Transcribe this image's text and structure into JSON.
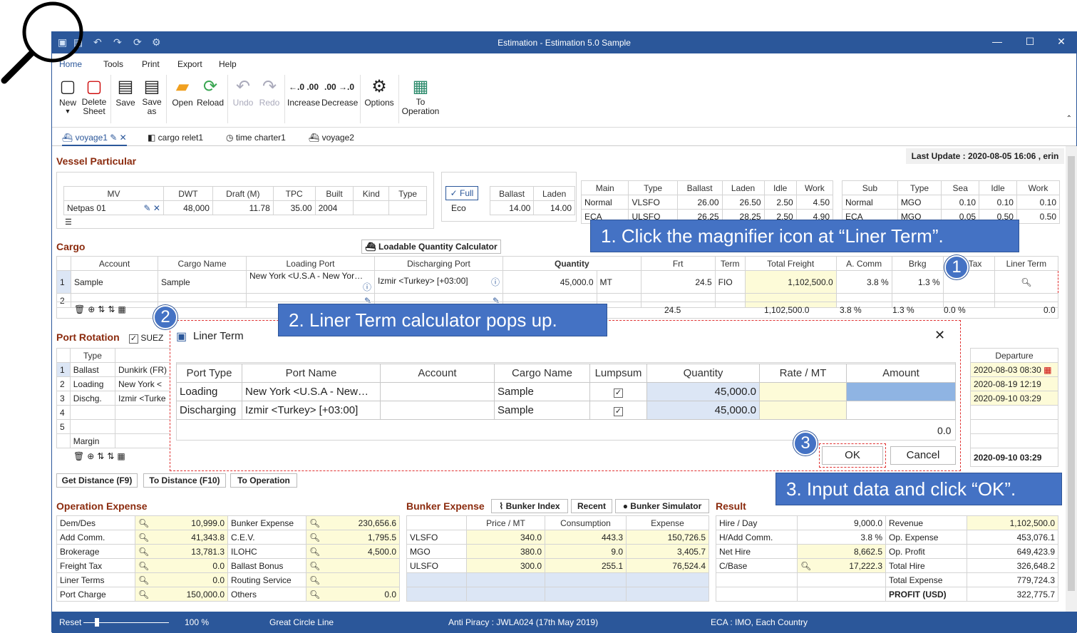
{
  "window": {
    "title": "Estimation - Estimation 5.0 Sample"
  },
  "menu": [
    "Home",
    "Tools",
    "Print",
    "Export",
    "Help"
  ],
  "ribbon": {
    "new": "New",
    "delete": "Delete\nSheet",
    "save": "Save",
    "save_as": "Save\nas",
    "open": "Open",
    "reload": "Reload",
    "undo": "Undo",
    "redo": "Redo",
    "increase": "Increase",
    "decrease": "Decrease",
    "options": "Options",
    "to_operation": "To\nOperation"
  },
  "tabs": [
    "voyage1",
    "cargo relet1",
    "time charter1",
    "voyage2"
  ],
  "last_update": "Last Update : 2020-08-05 16:06 , erin",
  "vessel": {
    "section": "Vessel Particular",
    "headers": [
      "MV",
      "DWT",
      "Draft (M)",
      "TPC",
      "Built",
      "Kind",
      "Type"
    ],
    "row": [
      "Netpas 01",
      "48,000",
      "11.78",
      "35.00",
      "2004",
      "",
      ""
    ]
  },
  "speed": {
    "full": "Full",
    "eco": "Eco",
    "headers": [
      "Ballast",
      "Laden"
    ],
    "row": [
      "14.00",
      "14.00"
    ]
  },
  "main_engine": {
    "headers": [
      "Main",
      "Type",
      "Ballast",
      "Laden",
      "Idle",
      "Work"
    ],
    "rows": [
      [
        "Normal",
        "VLSFO",
        "26.00",
        "26.50",
        "2.50",
        "4.50"
      ],
      [
        "ECA",
        "ULSFO",
        "26.25",
        "28.25",
        "2.50",
        "4.90"
      ]
    ]
  },
  "sub_engine": {
    "headers": [
      "Sub",
      "Type",
      "Sea",
      "Idle",
      "Work"
    ],
    "rows": [
      [
        "Normal",
        "MGO",
        "0.10",
        "0.10",
        "0.10"
      ],
      [
        "ECA",
        "MGO",
        "0.05",
        "0.50",
        "0.50"
      ]
    ]
  },
  "cargo": {
    "section": "Cargo",
    "lqc": "Loadable Quantity Calculator",
    "headers": [
      "Account",
      "Cargo Name",
      "Loading Port",
      "Discharging Port",
      "Quantity",
      "Frt",
      "Term",
      "Total Freight",
      "A. Comm",
      "Brkg",
      "Frt Tax",
      "Liner Term"
    ],
    "row": [
      "Sample",
      "Sample",
      "New York <U.S.A - New Yor…",
      "Izmir <Turkey> [+03:00]",
      "45,000.0",
      "MT",
      "24.5",
      "FIO",
      "1,102,500.0",
      "3.8 %",
      "1.3 %"
    ],
    "totals": [
      "24.5",
      "1,102,500.0",
      "3.8 %",
      "1.3 %",
      "0.0 %",
      "0.0"
    ]
  },
  "port_rotation": {
    "section": "Port Rotation",
    "suez": "SUEZ",
    "col_type": "Type",
    "col_departure": "Departure",
    "types": [
      "Ballast",
      "Loading",
      "Dischg."
    ],
    "ports": [
      "Dunkirk (FR)",
      "New York <",
      "Izmir <Turke"
    ],
    "margin": "Margin",
    "departures": [
      "2020-08-03 08:30",
      "2020-08-19 12:19",
      "2020-09-10 03:29"
    ],
    "final_departure": "2020-09-10 03:29"
  },
  "nav_buttons": [
    "Get Distance (F9)",
    "To Distance (F10)",
    "To Operation"
  ],
  "dialog": {
    "title": "Liner Term",
    "headers": [
      "Port Type",
      "Port Name",
      "Account",
      "Cargo Name",
      "Lumpsum",
      "Quantity",
      "Rate / MT",
      "Amount"
    ],
    "rows": [
      [
        "Loading",
        "New York <U.S.A - New…",
        "",
        "Sample",
        "✓",
        "45,000.0",
        "",
        ""
      ],
      [
        "Discharging",
        "Izmir <Turkey> [+03:00]",
        "",
        "Sample",
        "✓",
        "45,000.0",
        "",
        ""
      ]
    ],
    "total": "0.0",
    "ok": "OK",
    "cancel": "Cancel"
  },
  "op_expense": {
    "section": "Operation Expense",
    "left": [
      [
        "Dem/Des",
        "10,999.0"
      ],
      [
        "Add Comm.",
        "41,343.8"
      ],
      [
        "Brokerage",
        "13,781.3"
      ],
      [
        "Freight Tax",
        "0.0"
      ],
      [
        "Liner Terms",
        "0.0"
      ],
      [
        "Port Charge",
        "150,000.0"
      ]
    ],
    "right": [
      [
        "Bunker Expense",
        "230,656.6"
      ],
      [
        "C.E.V.",
        "1,795.5"
      ],
      [
        "ILOHC",
        "4,500.0"
      ],
      [
        "Ballast Bonus",
        ""
      ],
      [
        "Routing Service",
        ""
      ],
      [
        "Others",
        "0.0"
      ]
    ]
  },
  "bunker": {
    "section": "Bunker Expense",
    "index": "Bunker Index",
    "recent": "Recent",
    "simulator": "Bunker Simulator",
    "headers": [
      "",
      "Price / MT",
      "Consumption",
      "Expense"
    ],
    "rows": [
      [
        "VLSFO",
        "340.0",
        "443.3",
        "150,726.5"
      ],
      [
        "MGO",
        "380.0",
        "9.0",
        "3,405.7"
      ],
      [
        "ULSFO",
        "300.0",
        "255.1",
        "76,524.4"
      ]
    ]
  },
  "result": {
    "section": "Result",
    "left": [
      [
        "Hire / Day",
        "9,000.0"
      ],
      [
        "H/Add Comm.",
        "3.8 %"
      ],
      [
        "Net Hire",
        "8,662.5"
      ],
      [
        "C/Base",
        "17,222.3"
      ]
    ],
    "right": [
      [
        "Revenue",
        "1,102,500.0"
      ],
      [
        "Op. Expense",
        "453,076.1"
      ],
      [
        "Op. Profit",
        "649,423.9"
      ],
      [
        "Total Hire",
        "326,648.2"
      ],
      [
        "Total Expense",
        "779,724.3"
      ],
      [
        "PROFIT (USD)",
        "322,775.7"
      ]
    ]
  },
  "status": {
    "reset": "Reset",
    "zoom": "100 %",
    "route": "Great Circle Line",
    "piracy": "Anti Piracy : JWLA024 (17th May 2019)",
    "eca": "ECA : IMO, Each Country"
  },
  "callouts": {
    "c1": "1.  Click the magnifier icon at “Liner Term”.",
    "c2": "2.  Liner Term calculator pops up.",
    "c3": "3.  Input data and click “OK”.",
    "n1": "1",
    "n2": "2",
    "n3": "3"
  }
}
